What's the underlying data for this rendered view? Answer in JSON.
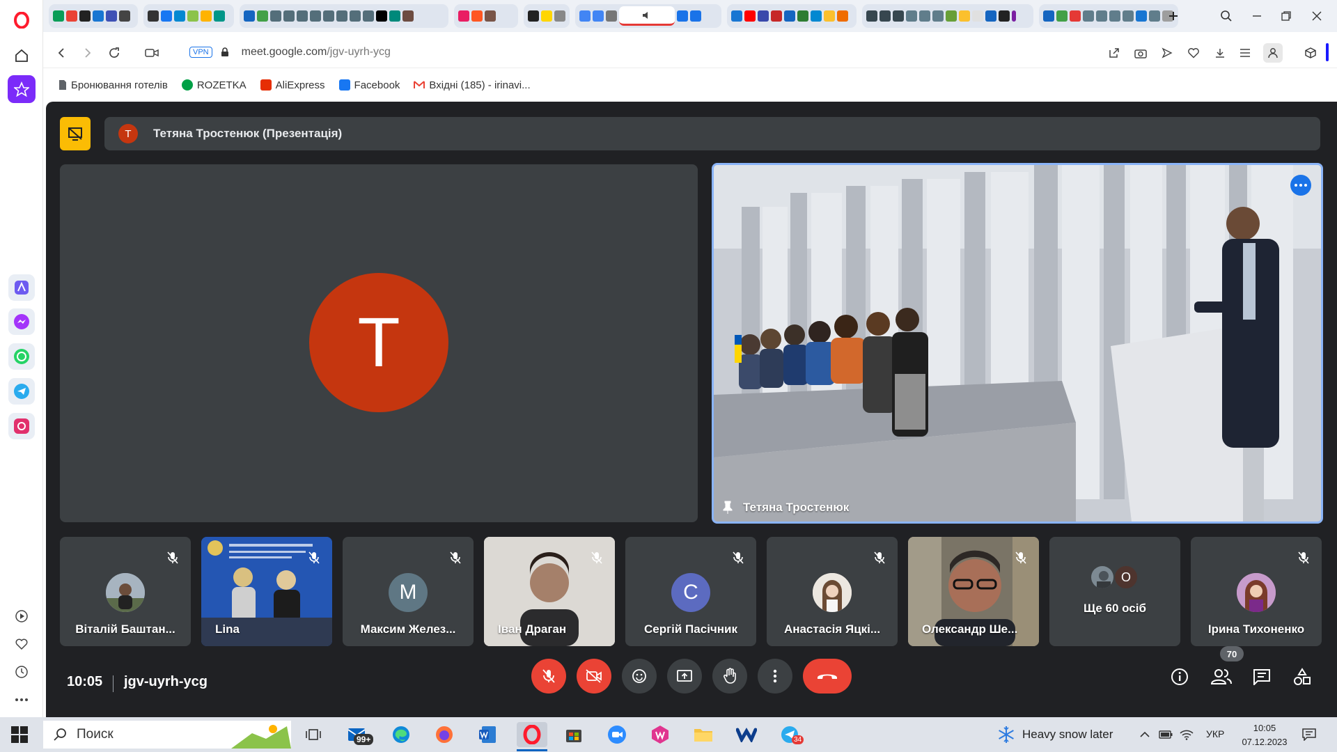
{
  "browser": {
    "url_host": "meet.google.com",
    "url_path": "/jgv-uyrh-ycg",
    "vpn_label": "VPN",
    "bookmarks": [
      {
        "label": "Бронювання готелів",
        "color": "#5f6368"
      },
      {
        "label": "ROZETKA",
        "color": "#00a046"
      },
      {
        "label": "AliExpress",
        "color": "#e62e04"
      },
      {
        "label": "Facebook",
        "color": "#1877f2"
      },
      {
        "label": "Вхідні (185) - irinavi...",
        "color": "#ea4335"
      }
    ]
  },
  "meet": {
    "presentation": {
      "avatar_initial": "Т",
      "title": "Тетяна Тростенюк (Презентація)"
    },
    "main_avatar_initial": "T",
    "pinned_name": "Тетяна Тростенюк",
    "participants": [
      {
        "name": "Віталій Баштан...",
        "type": "photo"
      },
      {
        "name": "Lina",
        "type": "video"
      },
      {
        "name": "Максим Желез...",
        "type": "initial",
        "initial": "М",
        "color": "#5f7784"
      },
      {
        "name": "Іван Драган",
        "type": "video"
      },
      {
        "name": "Сергій Пасічник",
        "type": "initial",
        "initial": "С",
        "color": "#5c6bc0"
      },
      {
        "name": "Анастасія Яцкі...",
        "type": "photo"
      },
      {
        "name": "Олександр Ше...",
        "type": "video"
      },
      {
        "name": "Ще 60 осіб",
        "type": "more",
        "initial": "О"
      },
      {
        "name": "Ірина Тихоненко",
        "type": "photo"
      }
    ],
    "time": "10:05",
    "code": "jgv-uyrh-ycg",
    "people_count": "70"
  },
  "taskbar": {
    "search_label": "Поиск",
    "mail_badge": "99+",
    "telegram_badge": "34",
    "weather": "Heavy snow later",
    "lang": "УКР",
    "time": "10:05",
    "date": "07.12.2023"
  },
  "colors": {
    "meet_bg": "#202124",
    "tile_bg": "#3c4043",
    "accent_red": "#ea4335",
    "avatar_red": "#c5360f",
    "highlight_blue": "#8ab4f8",
    "present_yellow": "#fbbc04"
  }
}
